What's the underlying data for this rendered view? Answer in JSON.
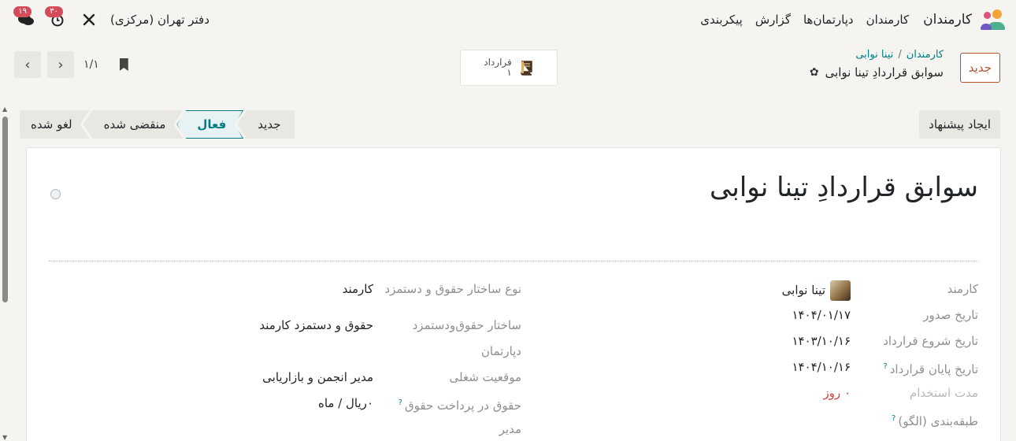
{
  "navbar": {
    "app_name": "کارمندان",
    "menu": [
      "کارمندان",
      "دپارتمان‌ها",
      "گزارش",
      "پیکربندی"
    ],
    "messages_badge": "۱۹",
    "activities_badge": "۳۰",
    "company": "دفتر تهران (مرکزی)"
  },
  "control": {
    "new_button": "جدید",
    "breadcrumb": [
      "کارمندان",
      "تینا نوابی"
    ],
    "breadcrumb_sep": "/",
    "record_title": "سوابق قراردادِ تینا نوابی",
    "smart_button": {
      "label": "قرارداد",
      "count": "۱"
    },
    "pager": {
      "value": "۱/۱"
    }
  },
  "status": {
    "proposal_button": "ایجاد پیشنهاد",
    "stages": [
      "جدید",
      "فعال",
      "منقضی شده",
      "لغو شده"
    ],
    "active_stage": "فعال"
  },
  "sheet": {
    "title": "سوابق قراردادِ تینا نوابی",
    "right_fields": [
      {
        "label": "کارمند",
        "value": "تینا نوابی"
      },
      {
        "label": "تاریخ صدور",
        "value": "۱۴۰۴/۰۱/۱۷"
      },
      {
        "label": "تاریخ شروع قرارداد",
        "value": "۱۴۰۳/۱۰/۱۶"
      },
      {
        "label": "تاریخ پایان قرارداد",
        "value": "۱۴۰۴/۱۰/۱۶"
      },
      {
        "label": "مدت استخدام",
        "value": "۰ روز"
      },
      {
        "label": "طبقه‌بندی (الگو)",
        "value": ""
      }
    ],
    "left_fields": [
      {
        "label": "نوع ساختار حقوق و دستمزد",
        "value": "کارمند"
      },
      {
        "label": "ساختار حقوق‌ودستمزد",
        "value": "حقوق و دستمزد کارمند"
      },
      {
        "label": "دپارتمان",
        "value": ""
      },
      {
        "label": "موقعیت شغلی",
        "value": "مدیر انجمن و بازاریابی"
      },
      {
        "label": "حقوق در پرداخت حقوق",
        "value": "۰ریال / ماه"
      },
      {
        "label": "مدیر",
        "value": ""
      }
    ]
  },
  "colors": {
    "accent": "#017e84",
    "brand": "#b3542b",
    "danger": "#d23f3a"
  }
}
